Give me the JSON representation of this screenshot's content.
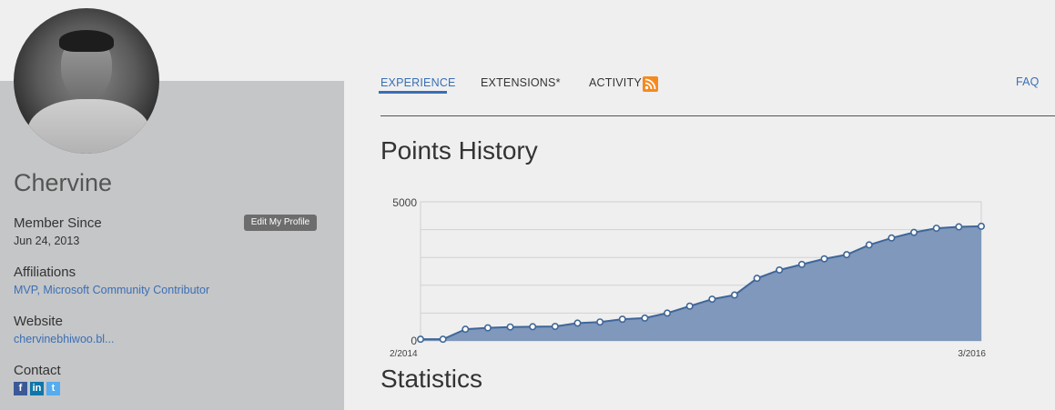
{
  "profile": {
    "name": "Chervine",
    "member_since_label": "Member Since",
    "member_since_value": "Jun 24, 2013",
    "edit_label": "Edit My Profile",
    "affiliations_label": "Affiliations",
    "affiliations_value": "MVP, Microsoft Community Contributor",
    "website_label": "Website",
    "website_value": "chervinebhiwoo.bl...",
    "contact_label": "Contact",
    "social": [
      "f",
      "in",
      "t"
    ]
  },
  "nav": {
    "tabs": [
      "EXPERIENCE",
      "EXTENSIONS*",
      "ACTIVITY"
    ],
    "faq": "FAQ",
    "accent": "#3a6fb5",
    "rss_icon": "rss-icon"
  },
  "points_history_title": "Points History",
  "statistics_title": "Statistics",
  "chart_data": {
    "type": "area",
    "x_tick_labels": [
      "2/2014",
      "3/2016"
    ],
    "y_tick_labels": [
      "0",
      "5000"
    ],
    "ylim": [
      0,
      5000
    ],
    "grid": true,
    "values": [
      60,
      60,
      420,
      470,
      500,
      510,
      520,
      640,
      680,
      780,
      820,
      1000,
      1250,
      1500,
      1650,
      2250,
      2550,
      2750,
      2950,
      3100,
      3450,
      3700,
      3900,
      4050,
      4100,
      4120
    ],
    "fill_color": "#7f98bb",
    "line_color": "#3f6698"
  }
}
